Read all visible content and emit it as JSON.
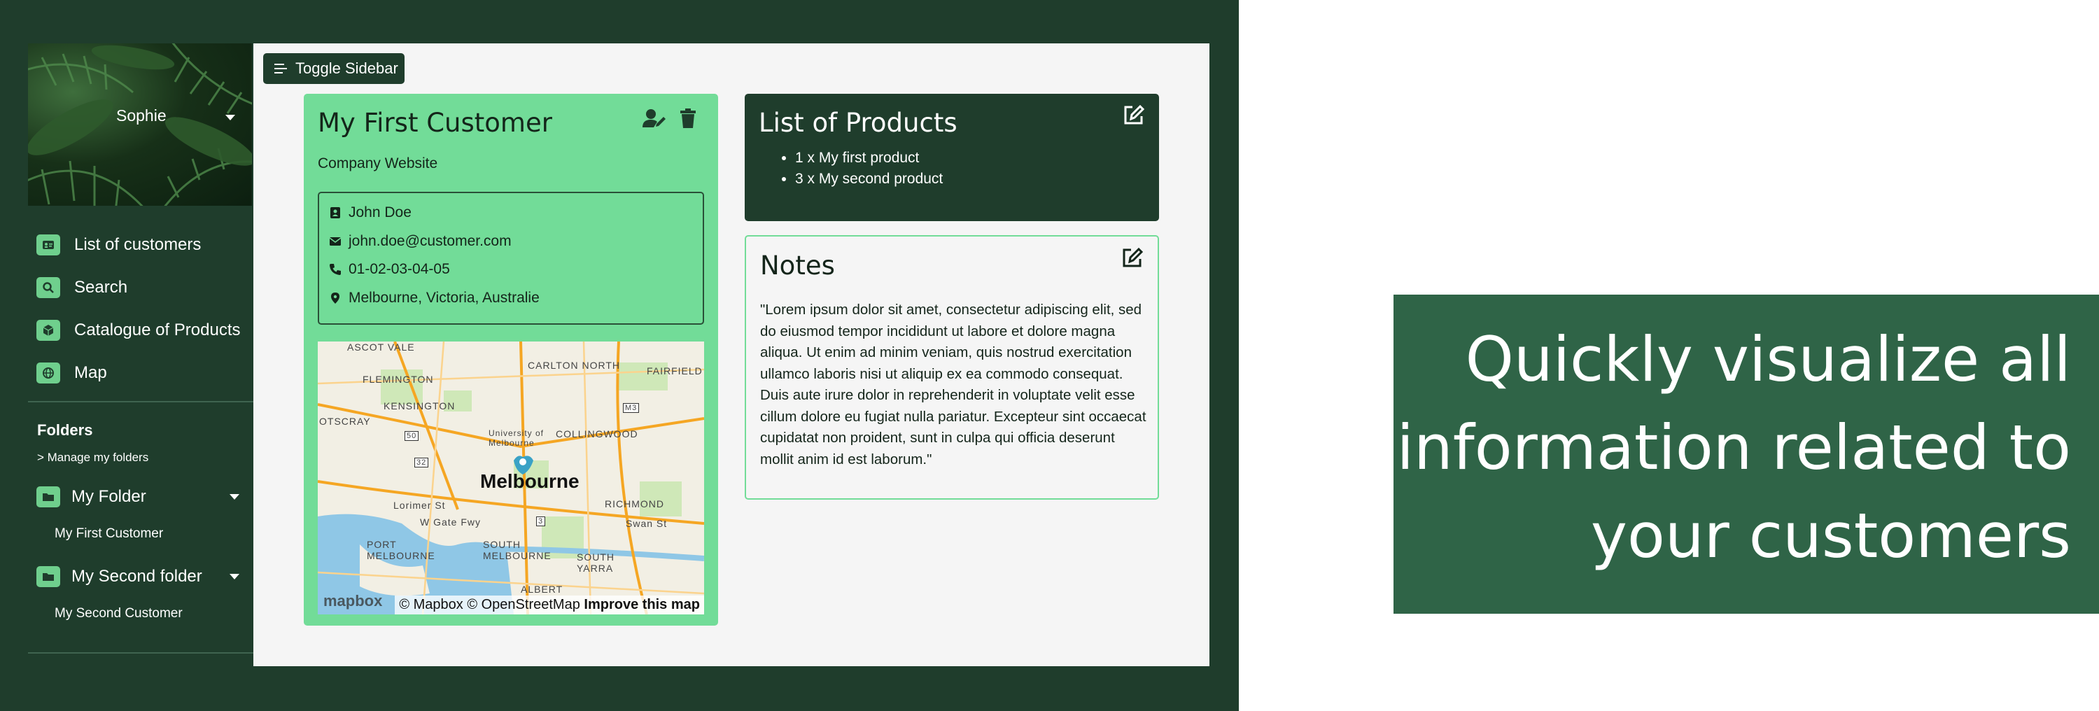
{
  "colors": {
    "dark_green": "#1f3d2c",
    "light_green": "#72dc98",
    "panel_bg": "#f5f5f5",
    "banner_green": "#2f6447"
  },
  "sidebar": {
    "user": "Sophie",
    "nav": [
      {
        "label": "List of customers",
        "icon": "id-card-icon"
      },
      {
        "label": "Search",
        "icon": "search-icon"
      },
      {
        "label": "Catalogue of Products",
        "icon": "box-icon"
      },
      {
        "label": "Map",
        "icon": "globe-icon"
      }
    ],
    "folders_title": "Folders",
    "manage_label": "> Manage my folders",
    "folders": [
      {
        "label": "My Folder",
        "icon": "folder-icon",
        "items": [
          "My First Customer"
        ]
      },
      {
        "label": "My Second folder",
        "icon": "folder-icon",
        "items": [
          "My Second Customer"
        ]
      }
    ]
  },
  "toolbar": {
    "toggle_label": "Toggle Sidebar",
    "toggle_icon": "menu-lines-icon"
  },
  "customer": {
    "name": "My First Customer",
    "website": "Company Website",
    "contact": {
      "name": "John Doe",
      "email": "john.doe@customer.com",
      "phone": "01-02-03-04-05",
      "address": "Melbourne, Victoria, Australie"
    },
    "actions": [
      "user-edit-icon",
      "trash-icon"
    ]
  },
  "map": {
    "city": "Melbourne",
    "labels": [
      "ASCOT VALE",
      "CARLTON NORTH",
      "FAIRFIELD",
      "FLEMINGTON",
      "KENSINGTON",
      "OTSCRAY",
      "University of Melbourne",
      "COLLINGWOOD",
      "RICHMOND",
      "Lorimer St",
      "W Gate Fwy",
      "PORT MELBOURNE",
      "SOUTH MELBOURNE",
      "SOUTH YARRA",
      "Swan St",
      "ALBERT"
    ],
    "road_numbers": [
      "M3",
      "50",
      "32",
      "3"
    ],
    "attribution": "© Mapbox © OpenStreetMap",
    "improve": "Improve this map",
    "logo": "mapbox"
  },
  "products": {
    "title": "List of Products",
    "items": [
      "1 x My first product",
      "3 x My second product"
    ],
    "edit_icon": "edit-icon"
  },
  "notes": {
    "title": "Notes",
    "text": "\"Lorem ipsum dolor sit amet, consectetur adipiscing elit, sed do eiusmod tempor incididunt ut labore et dolore magna aliqua. Ut enim ad minim veniam, quis nostrud exercitation ullamco laboris nisi ut aliquip ex ea commodo consequat. Duis aute irure dolor in reprehenderit in voluptate velit esse cillum dolore eu fugiat nulla pariatur. Excepteur sint occaecat cupidatat non proident, sunt in culpa qui officia deserunt mollit anim id est laborum.\"",
    "edit_icon": "edit-icon"
  },
  "banner": {
    "line1": "Quickly visualize all",
    "line2": "information related to",
    "line3": "your customers"
  }
}
